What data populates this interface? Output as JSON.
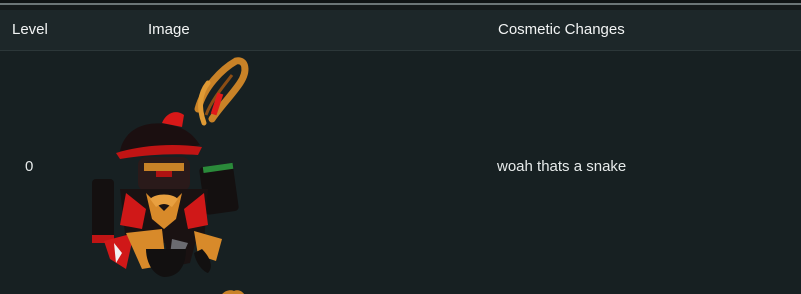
{
  "table": {
    "headers": {
      "level": "Level",
      "image": "Image",
      "changes": "Cosmetic Changes"
    },
    "rows": [
      {
        "level": "0",
        "image_icon": "avatar-character-icon",
        "changes": "woah thats a snake"
      }
    ]
  },
  "colors": {
    "background": "#172022",
    "header_background": "#1d2729",
    "text": "#e6eaea",
    "accent_red": "#d01818",
    "accent_gold": "#d88a2a"
  }
}
